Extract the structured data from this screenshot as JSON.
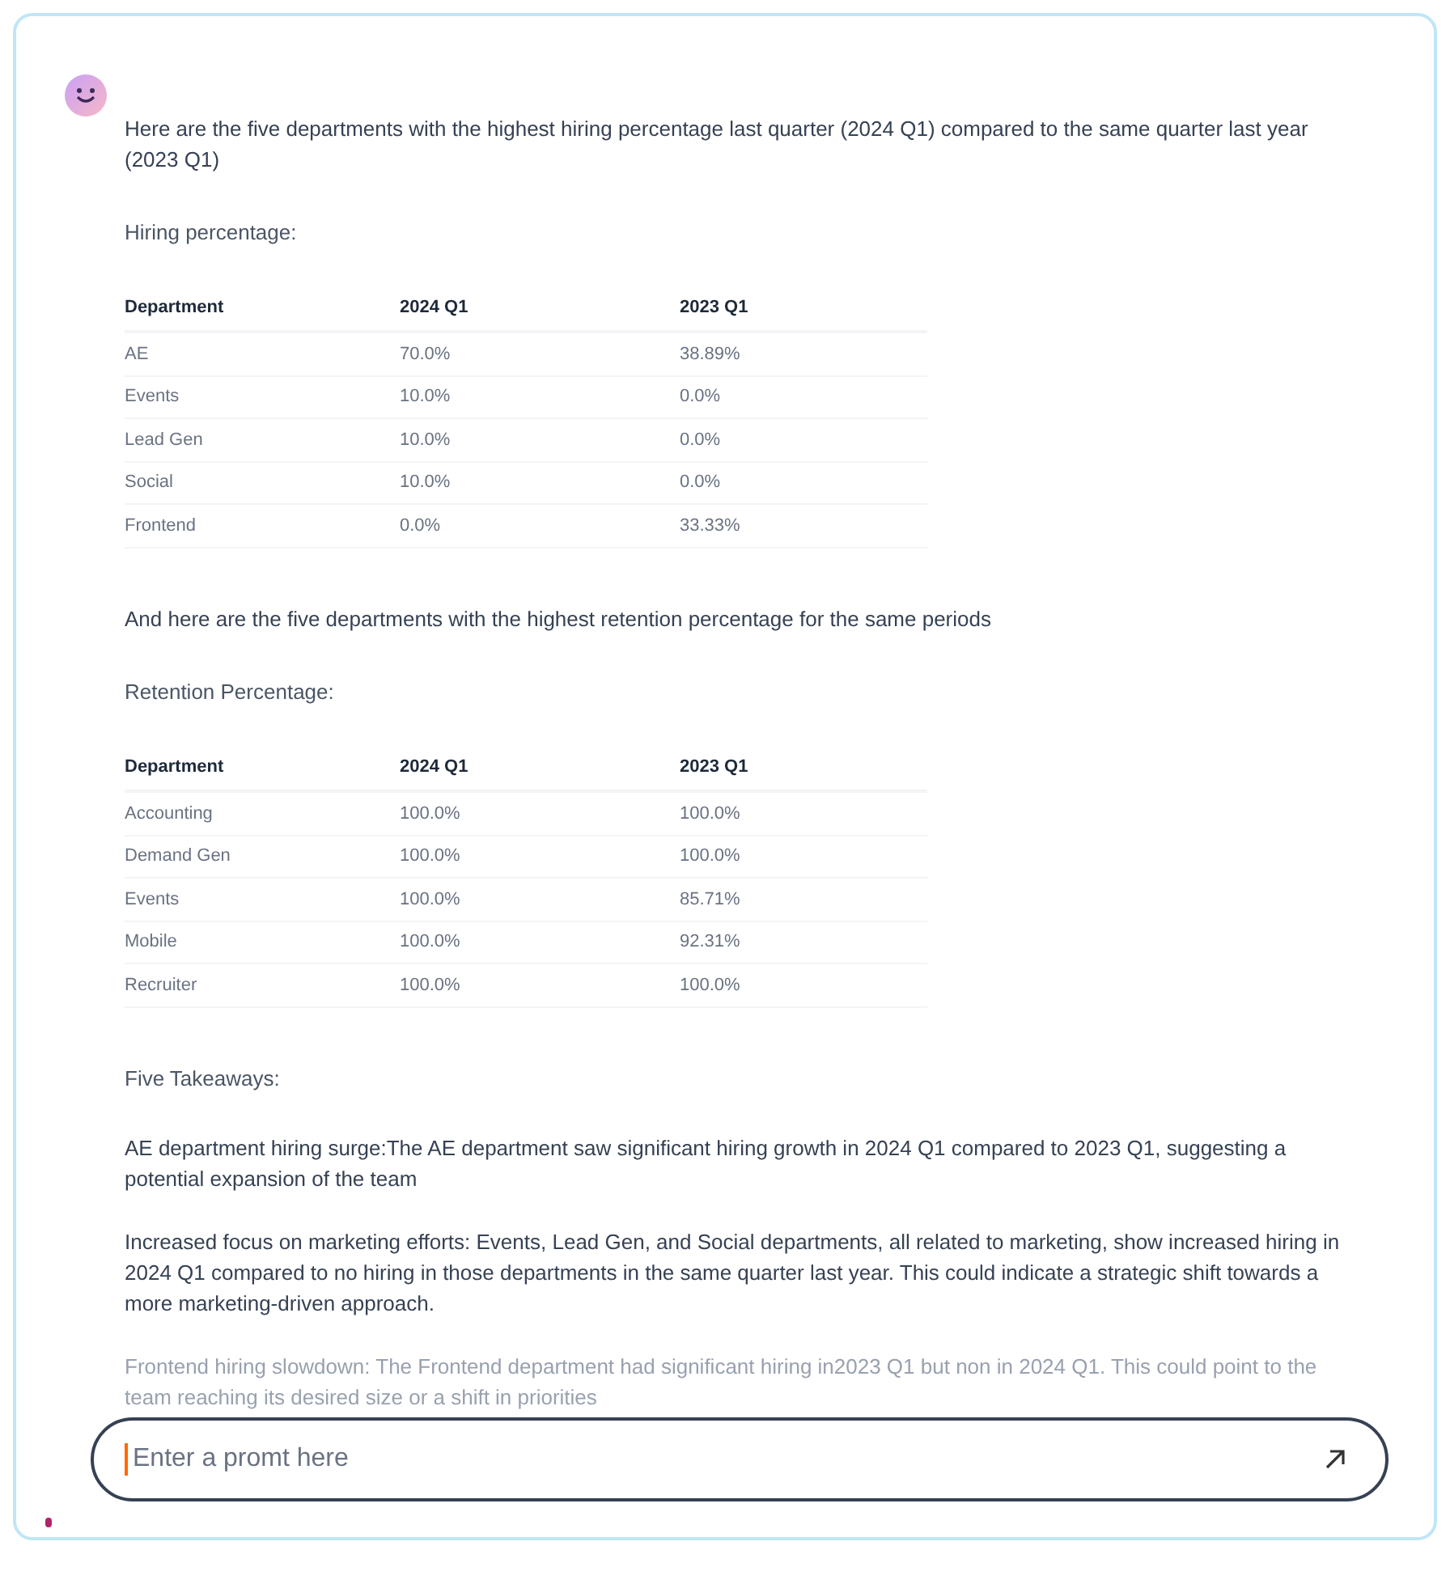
{
  "message": {
    "intro": "Here are the five departments with the highest hiring percentage last quarter (2024 Q1) compared to the same quarter last year (2023 Q1)",
    "tables": [
      {
        "title": "Hiring percentage:",
        "columns": [
          "Department",
          "2024 Q1",
          "2023 Q1"
        ],
        "rows": [
          [
            "AE",
            "70.0%",
            "38.89%"
          ],
          [
            "Events",
            "10.0%",
            "0.0%"
          ],
          [
            "Lead Gen",
            "10.0%",
            "0.0%"
          ],
          [
            "Social",
            "10.0%",
            "0.0%"
          ],
          [
            "Frontend",
            "0.0%",
            "33.33%"
          ]
        ],
        "after": "And here are the five departments with the highest retention percentage for the same periods"
      },
      {
        "title": "Retention Percentage:",
        "columns": [
          "Department",
          "2024 Q1",
          "2023 Q1"
        ],
        "rows": [
          [
            "Accounting",
            "100.0%",
            "100.0%"
          ],
          [
            "Demand Gen",
            "100.0%",
            "100.0%"
          ],
          [
            "Events",
            "100.0%",
            "85.71%"
          ],
          [
            "Mobile",
            "100.0%",
            "92.31%"
          ],
          [
            "Recruiter",
            "100.0%",
            "100.0%"
          ]
        ]
      }
    ],
    "takeaways_title": "Five Takeaways:",
    "takeaways": [
      {
        "text": "AE department hiring surge:The AE department saw significant hiring growth in 2024 Q1 compared to 2023 Q1, suggesting a potential expansion of the team",
        "faded": false
      },
      {
        "text": "Increased focus on marketing efforts: Events, Lead Gen, and Social departments, all related to marketing, show increased hiring in 2024 Q1 compared to no hiring in those departments in the same quarter last year. This could indicate a strategic shift towards a more marketing-driven approach.",
        "faded": false
      },
      {
        "text": "Frontend hiring slowdown: The Frontend department had significant hiring in2023 Q1 but non in 2024 Q1. This could point to the team reaching its desired size or a shift in priorities",
        "faded": true
      }
    ]
  },
  "prompt": {
    "placeholder": "Enter a promt here"
  }
}
